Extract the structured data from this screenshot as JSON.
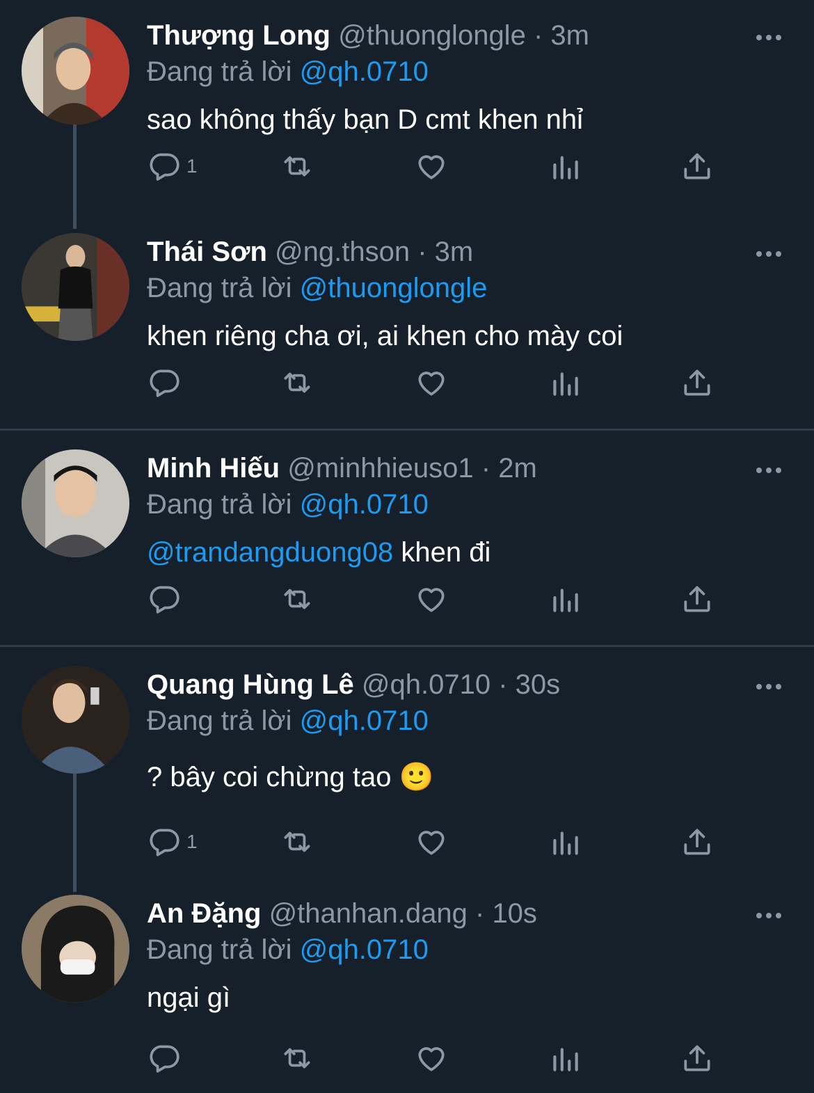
{
  "colors": {
    "background": "#15202b",
    "text": "#ffffff",
    "muted": "#8b98a5",
    "accent": "#1d9bf0",
    "divider": "#2f3d4a"
  },
  "replying_label": "Đang trả lời",
  "tweets": [
    {
      "name": "Thượng Long",
      "handle": "@thuonglongle",
      "time": "3m",
      "replying_to": "@qh.0710",
      "text": "sao không thấy bạn D cmt khen nhỉ",
      "text_mention": "",
      "reply_count": "1",
      "icons": [
        "more-icon",
        "reply-icon",
        "retweet-icon",
        "like-icon",
        "views-icon",
        "share-icon"
      ]
    },
    {
      "name": "Thái Sơn",
      "handle": "@ng.thson",
      "time": "3m",
      "replying_to": "@thuonglongle",
      "text": "khen riêng cha ơi, ai khen cho mày coi",
      "text_mention": "",
      "reply_count": ""
    },
    {
      "name": "Minh Hiếu",
      "handle": "@minhhieuso1",
      "time": "2m",
      "replying_to": "@qh.0710",
      "text": " khen đi",
      "text_mention": "@trandangduong08",
      "reply_count": ""
    },
    {
      "name": "Quang Hùng Lê",
      "handle": "@qh.0710",
      "time": "30s",
      "replying_to": "@qh.0710",
      "text": "? bây coi chừng tao 🙂",
      "text_mention": "",
      "reply_count": "1"
    },
    {
      "name": "An Đặng",
      "handle": "@thanhan.dang",
      "time": "10s",
      "replying_to": "@qh.0710",
      "text": "ngại gì",
      "text_mention": "",
      "reply_count": ""
    }
  ]
}
